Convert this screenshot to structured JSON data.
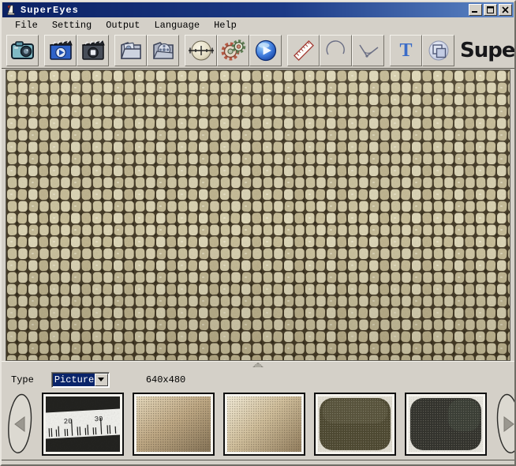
{
  "window": {
    "title": "SuperEyes",
    "icon": "supereyes-app-icon",
    "controls": [
      "minimize",
      "maximize",
      "close"
    ]
  },
  "menu": {
    "items": [
      "File",
      "Setting",
      "Output",
      "Language",
      "Help"
    ]
  },
  "toolbar": {
    "icons": [
      "capture-photo",
      "record-video-start",
      "record-video-stop",
      "browse-photos-folder",
      "browse-videos-folder",
      "crosshair-calibrate",
      "settings-gears",
      "play-video",
      "measure-ruler",
      "measure-arc",
      "measure-angle",
      "text-annotation",
      "compare-windows"
    ],
    "text_tool_glyph": "T",
    "logo": "Superëyës"
  },
  "viewer": {
    "content": "live microscope view of woven burlap fabric"
  },
  "controls": {
    "type_label": "Type",
    "type_value": "Picture",
    "resolution": "640x480"
  },
  "filmstrip": {
    "prev": "previous-thumbnails",
    "next": "next-thumbnails",
    "thumbnails": [
      {
        "name": "ruler-calibration-photo",
        "labels": [
          "20",
          "30"
        ]
      },
      {
        "name": "tan-fabric-photo"
      },
      {
        "name": "light-tan-fabric-photo"
      },
      {
        "name": "dark-olive-mesh-photo"
      },
      {
        "name": "black-mesh-photo"
      }
    ]
  },
  "colors": {
    "chrome": "#d4d0c8",
    "titlebar_left": "#0b2163",
    "titlebar_right": "#5d86c6",
    "selection": "#0a246a",
    "fabric_light": "#d9d1af",
    "fabric_gap": "#473d29"
  }
}
